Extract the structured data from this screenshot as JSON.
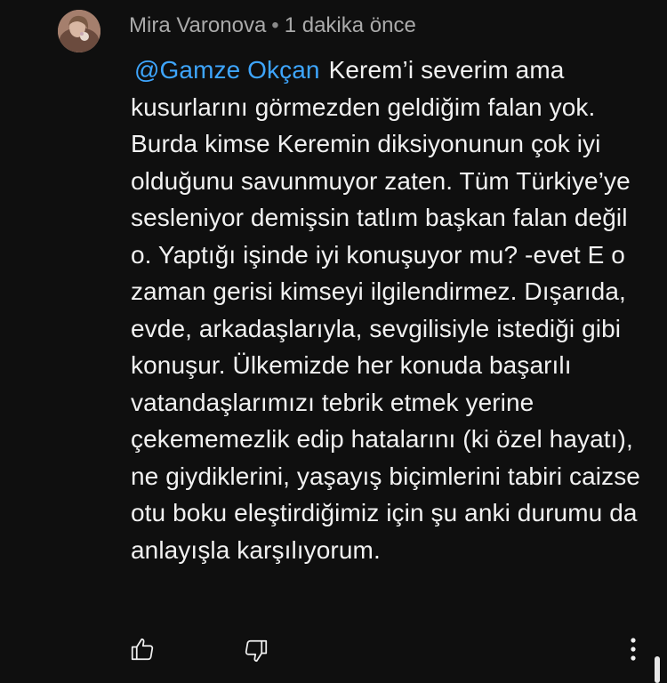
{
  "comment": {
    "author": "Mira Varonova",
    "separator": "•",
    "timestamp": "1 dakika önce",
    "mention": "@Gamze Okçan",
    "text": "Kerem’i severim ama kusurlarını görmezden geldiğim falan yok. Burda kimse Keremin diksiyonunun çok iyi olduğunu savunmuyor zaten. Tüm Türkiye’ye sesleniyor demişsin tatlım başkan falan değil o. Yaptığı işinde iyi konuşuyor mu? -evet E o zaman gerisi kimseyi ilgilendirmez. Dışarıda, evde, arkadaşlarıyla, sevgilisiyle istediği gibi konuşur. Ülkemizde her konuda başarılı vatandaşlarımızı tebrik etmek yerine çekememezlik edip hatalarını (ki özel hayatı), ne giydiklerini, yaşayış biçimlerini tabiri caizse otu boku eleştirdiğimiz için şu anki durumu da anlayışla karşılıyorum."
  },
  "actions": {
    "like_icon": "thumb-up-icon",
    "dislike_icon": "thumb-down-icon",
    "more_icon": "more-vertical-icon"
  },
  "colors": {
    "background": "#0f0f0f",
    "text": "#f1f1f1",
    "meta": "#aaaaaa",
    "mention": "#3ea6ff"
  }
}
